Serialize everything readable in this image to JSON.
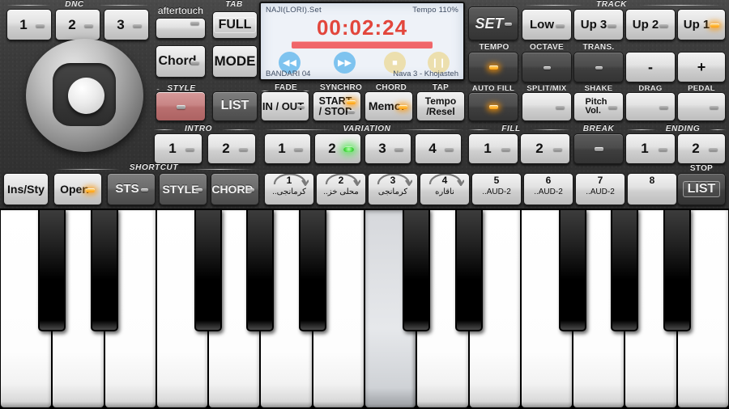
{
  "lcd": {
    "set_name": "NAJI(LORI).Set",
    "tempo": "Tempo 110%",
    "time": "00:02:24",
    "style_name": "BANDARI 04",
    "voice_name": "Nava 3 - Khojasteh",
    "transport": {
      "rewind": "◀◀",
      "forward": "▶▶",
      "stop": "■",
      "pause": "❙❙"
    },
    "colors": {
      "time": "#e2463c",
      "bar": "#f0666a",
      "blue": "#7ec3ef",
      "tan": "#ecdfae"
    }
  },
  "dnc": {
    "caption": "DNC",
    "buttons": [
      {
        "label": "1"
      },
      {
        "label": "2"
      },
      {
        "label": "3"
      }
    ]
  },
  "aftertouch": {
    "label": "aftertouch"
  },
  "tab": {
    "caption": "TAB",
    "full": "FULL",
    "mode": "MODE",
    "chord": "Chord"
  },
  "style": {
    "caption": "STYLE",
    "list": "LIST"
  },
  "intro": {
    "caption": "INTRO",
    "buttons": [
      {
        "label": "1"
      },
      {
        "label": "2"
      }
    ]
  },
  "fade": {
    "caption": "FADE",
    "label": "IN / OUT"
  },
  "synchro": {
    "caption": "SYNCHRO",
    "label_top": "START",
    "label_bot": "/ STOP"
  },
  "chord_sec": {
    "caption": "CHORD",
    "label": "Memo."
  },
  "tap": {
    "caption": "TAP",
    "label_top": "Tempo",
    "label_bot": "/Resel"
  },
  "variation": {
    "caption": "VARIATION",
    "buttons": [
      {
        "label": "1",
        "led": "dash"
      },
      {
        "label": "2",
        "led": "green"
      },
      {
        "label": "3",
        "led": "dash"
      },
      {
        "label": "4",
        "led": "dash"
      }
    ]
  },
  "set_button": {
    "label": "SET"
  },
  "track": {
    "caption": "TRACK",
    "buttons": [
      {
        "label": "Low",
        "led": "dash"
      },
      {
        "label": "Up 3",
        "led": "dash"
      },
      {
        "label": "Up 2",
        "led": "dash"
      },
      {
        "label": "Up 1",
        "led": "amber"
      }
    ]
  },
  "row2_right": {
    "tempo_cap": "TEMPO",
    "octave_cap": "OCTAVE",
    "trans_cap": "TRANS.",
    "minus": "-",
    "plus": "+"
  },
  "row3_right": {
    "auto_fill": "AUTO FILL",
    "split_mix": "SPLIT/MIX",
    "shake": "SHAKE",
    "shake_l1": "Pitch",
    "shake_l2": "Vol.",
    "drag": "DRAG",
    "pedal": "PEDAL"
  },
  "fill": {
    "caption": "FILL",
    "buttons": [
      {
        "label": "1"
      },
      {
        "label": "2"
      }
    ]
  },
  "break": {
    "caption": "BREAK"
  },
  "ending": {
    "caption": "ENDING",
    "buttons": [
      {
        "label": "1"
      },
      {
        "label": "2"
      }
    ]
  },
  "shortcut": {
    "caption": "SHORTCUT",
    "ins_sty": "Ins/Sty",
    "open": "Open",
    "sts": "STS",
    "style": "STYLE",
    "chord": "CHORD"
  },
  "pads": [
    {
      "num": "1",
      "label": "کرمانجی..",
      "arrow": true
    },
    {
      "num": "2",
      "label": "محلی خز..",
      "arrow": true
    },
    {
      "num": "3",
      "label": "کرمانجی",
      "arrow": true
    },
    {
      "num": "4",
      "label": "ناقاره",
      "arrow": true
    },
    {
      "num": "5",
      "label": "AUD-2..",
      "arrow": false
    },
    {
      "num": "6",
      "label": "AUD-2..",
      "arrow": false
    },
    {
      "num": "7",
      "label": "AUD-2..",
      "arrow": false
    },
    {
      "num": "8",
      "label": "",
      "arrow": false
    }
  ],
  "stop": {
    "caption": "STOP",
    "label": "LIST"
  },
  "keyboard": {
    "white_key_count": 14,
    "pressed_white_key_index": 7,
    "black_key_pattern": [
      1,
      1,
      0,
      1,
      1,
      1,
      0
    ]
  }
}
